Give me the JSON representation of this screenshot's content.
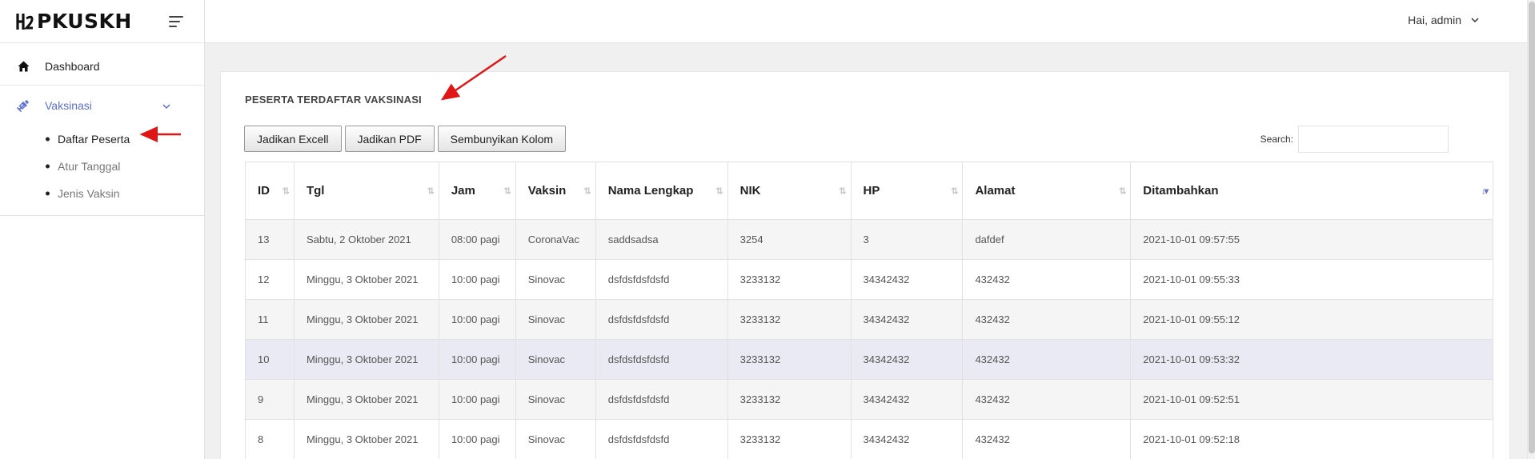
{
  "app": {
    "brand": "PKUSKH"
  },
  "sidebar": {
    "items": [
      {
        "label": "Dashboard",
        "icon": "home-icon"
      },
      {
        "label": "Vaksinasi",
        "icon": "syringe-icon",
        "expanded": true
      }
    ],
    "subitems": [
      {
        "label": "Daftar Peserta",
        "active": true
      },
      {
        "label": "Atur Tanggal"
      },
      {
        "label": "Jenis Vaksin"
      }
    ]
  },
  "topbar": {
    "user_label": "Hai, admin"
  },
  "card": {
    "title": "PESERTA TERDAFTAR VAKSINASI"
  },
  "toolbar": {
    "excel_label": "Jadikan Excell",
    "pdf_label": "Jadikan PDF",
    "columns_label": "Sembunyikan Kolom"
  },
  "search": {
    "label": "Search:",
    "value": ""
  },
  "table": {
    "columns": [
      "ID",
      "Tgl",
      "Jam",
      "Vaksin",
      "Nama Lengkap",
      "NIK",
      "HP",
      "Alamat",
      "Ditambahkan"
    ],
    "rows": [
      [
        "13",
        "Sabtu, 2 Oktober 2021",
        "08:00 pagi",
        "CoronaVac",
        "saddsadsa",
        "3254",
        "3",
        "dafdef",
        "2021-10-01 09:57:55"
      ],
      [
        "12",
        "Minggu, 3 Oktober 2021",
        "10:00 pagi",
        "Sinovac",
        "dsfdsfdsfdsfd",
        "3233132",
        "34342432",
        "432432",
        "2021-10-01 09:55:33"
      ],
      [
        "11",
        "Minggu, 3 Oktober 2021",
        "10:00 pagi",
        "Sinovac",
        "dsfdsfdsfdsfd",
        "3233132",
        "34342432",
        "432432",
        "2021-10-01 09:55:12"
      ],
      [
        "10",
        "Minggu, 3 Oktober 2021",
        "10:00 pagi",
        "Sinovac",
        "dsfdsfdsfdsfd",
        "3233132",
        "34342432",
        "432432",
        "2021-10-01 09:53:32"
      ],
      [
        "9",
        "Minggu, 3 Oktober 2021",
        "10:00 pagi",
        "Sinovac",
        "dsfdsfdsfdsfd",
        "3233132",
        "34342432",
        "432432",
        "2021-10-01 09:52:51"
      ],
      [
        "8",
        "Minggu, 3 Oktober 2021",
        "10:00 pagi",
        "Sinovac",
        "dsfdsfdsfdsfd",
        "3233132",
        "34342432",
        "432432",
        "2021-10-01 09:52:18"
      ]
    ],
    "sorted_column": "Ditambahkan",
    "sort_direction": "desc"
  },
  "colors": {
    "accent": "#5a6fd1",
    "annotation_arrow": "#e01515",
    "highlight_row": "#e9eaf3",
    "stripe_row": "#f5f5f5"
  }
}
